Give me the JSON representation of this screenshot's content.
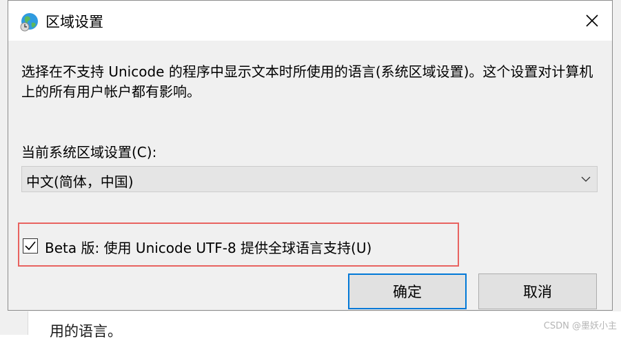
{
  "dialog": {
    "title": "区域设置",
    "icon": "globe-icon",
    "close_icon": "close-icon",
    "description": "选择在不支持 Unicode 的程序中显示文本时所使用的语言(系统区域设置)。这个设置对计算机上的所有用户帐户都有影响。",
    "locale_label": "当前系统区域设置(C):",
    "locale_value": "中文(简体，中国)",
    "beta_label": "Beta 版: 使用 Unicode UTF-8 提供全球语言支持(U)",
    "beta_checked": true,
    "ok_label": "确定",
    "cancel_label": "取消"
  },
  "background": {
    "partial_text": "用的语言。"
  },
  "watermark": "CSDN @墨妖小主",
  "colors": {
    "accent": "#0078d7",
    "highlight": "#e8625f"
  }
}
